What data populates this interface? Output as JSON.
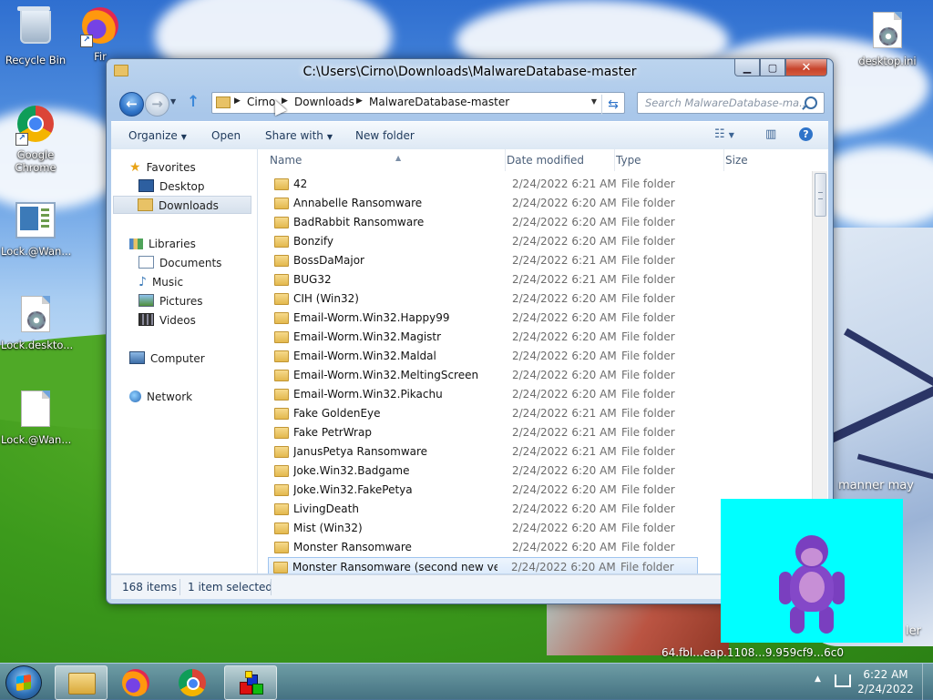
{
  "desktop": {
    "icons": [
      {
        "label": "Recycle Bin",
        "icon": "recycle-bin-icon"
      },
      {
        "label": "Fir",
        "icon": "firefox-icon"
      },
      {
        "label": "Google Chrome",
        "icon": "chrome-icon"
      },
      {
        "label": "Lock.@Wan...",
        "icon": "image-file-icon"
      },
      {
        "label": "Lock.deskto...",
        "icon": "settings-file-icon"
      },
      {
        "label": "Lock.@Wan...",
        "icon": "blank-file-icon"
      },
      {
        "label": "desktop.ini",
        "icon": "settings-file-icon"
      }
    ],
    "overlay_text_1": "manner may",
    "overlay_text_2": "64.fbl...eap.1108...9.959cf9...6c0",
    "overlay_text_3": "ler"
  },
  "window": {
    "title": "C:\\Users\\Cirno\\Downloads\\MalwareDatabase-master",
    "breadcrumb": [
      "Cirno",
      "Downloads",
      "MalwareDatabase-master"
    ],
    "search_placeholder": "Search MalwareDatabase-ma...",
    "toolbar": {
      "organize": "Organize",
      "open": "Open",
      "share_with": "Share with",
      "new_folder": "New folder"
    },
    "nav_pane": {
      "favorites": "Favorites",
      "desktop": "Desktop",
      "downloads": "Downloads",
      "libraries": "Libraries",
      "documents": "Documents",
      "music": "Music",
      "pictures": "Pictures",
      "videos": "Videos",
      "computer": "Computer",
      "network": "Network"
    },
    "columns": {
      "name": "Name",
      "date_modified": "Date modified",
      "type": "Type",
      "size": "Size"
    },
    "files": [
      {
        "name": "42",
        "date": "2/24/2022 6:21 AM",
        "type": "File folder"
      },
      {
        "name": "Annabelle Ransomware",
        "date": "2/24/2022 6:20 AM",
        "type": "File folder"
      },
      {
        "name": "BadRabbit Ransomware",
        "date": "2/24/2022 6:20 AM",
        "type": "File folder"
      },
      {
        "name": "Bonzify",
        "date": "2/24/2022 6:20 AM",
        "type": "File folder"
      },
      {
        "name": "BossDaMajor",
        "date": "2/24/2022 6:21 AM",
        "type": "File folder"
      },
      {
        "name": "BUG32",
        "date": "2/24/2022 6:21 AM",
        "type": "File folder"
      },
      {
        "name": "CIH (Win32)",
        "date": "2/24/2022 6:20 AM",
        "type": "File folder"
      },
      {
        "name": "Email-Worm.Win32.Happy99",
        "date": "2/24/2022 6:20 AM",
        "type": "File folder"
      },
      {
        "name": "Email-Worm.Win32.Magistr",
        "date": "2/24/2022 6:20 AM",
        "type": "File folder"
      },
      {
        "name": "Email-Worm.Win32.Maldal",
        "date": "2/24/2022 6:20 AM",
        "type": "File folder"
      },
      {
        "name": "Email-Worm.Win32.MeltingScreen",
        "date": "2/24/2022 6:20 AM",
        "type": "File folder"
      },
      {
        "name": "Email-Worm.Win32.Pikachu",
        "date": "2/24/2022 6:20 AM",
        "type": "File folder"
      },
      {
        "name": "Fake GoldenEye",
        "date": "2/24/2022 6:21 AM",
        "type": "File folder"
      },
      {
        "name": "Fake PetrWrap",
        "date": "2/24/2022 6:21 AM",
        "type": "File folder"
      },
      {
        "name": "JanusPetya Ransomware",
        "date": "2/24/2022 6:21 AM",
        "type": "File folder"
      },
      {
        "name": "Joke.Win32.Badgame",
        "date": "2/24/2022 6:20 AM",
        "type": "File folder"
      },
      {
        "name": "Joke.Win32.FakePetya",
        "date": "2/24/2022 6:20 AM",
        "type": "File folder"
      },
      {
        "name": "LivingDeath",
        "date": "2/24/2022 6:20 AM",
        "type": "File folder"
      },
      {
        "name": "Mist (Win32)",
        "date": "2/24/2022 6:20 AM",
        "type": "File folder"
      },
      {
        "name": "Monster Ransomware",
        "date": "2/24/2022 6:20 AM",
        "type": "File folder"
      },
      {
        "name": "Monster Ransomware (second new versi...",
        "date": "2/24/2022 6:20 AM",
        "type": "File folder",
        "selected": true
      }
    ],
    "status": {
      "item_count": "168 items",
      "selection": "1 item selected"
    }
  },
  "taskbar": {
    "time": "6:22 AM",
    "date": "2/24/2022"
  }
}
